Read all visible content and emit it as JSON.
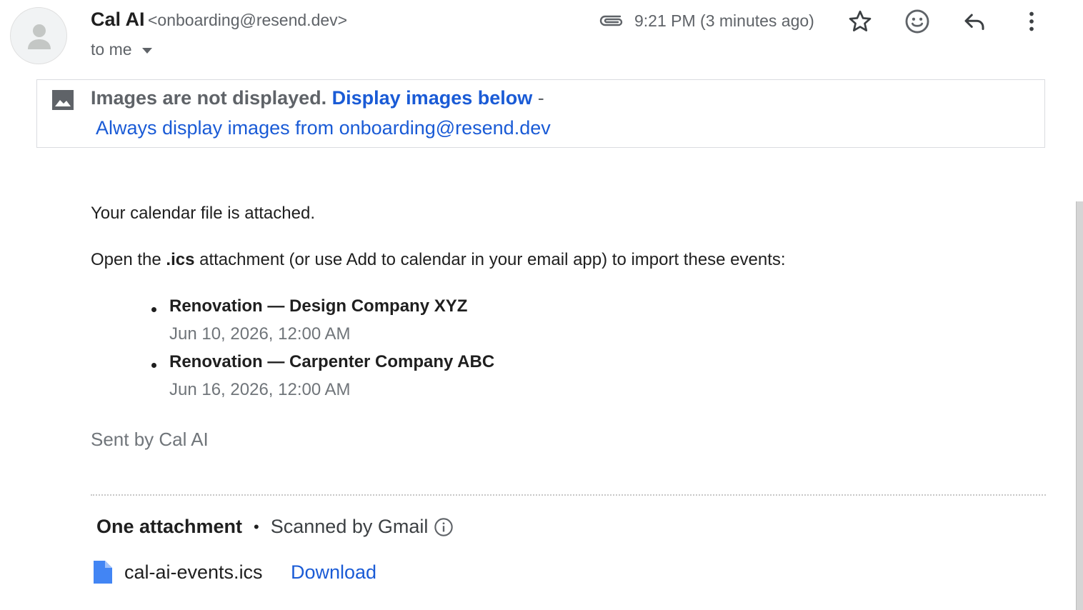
{
  "header": {
    "sender_name": "Cal AI",
    "sender_email": "<onboarding@resend.dev>",
    "recipient_label": "to me",
    "timestamp": "9:21 PM (3 minutes ago)",
    "icons": [
      "attachment-clip-icon",
      "star-icon",
      "emoji-icon",
      "reply-icon",
      "more-vert-icon"
    ]
  },
  "image_banner": {
    "notice": "Images are not displayed.",
    "display_link": "Display images below",
    "separator": "-",
    "always_link": "Always display images from onboarding@resend.dev"
  },
  "message": {
    "line1": "Your calendar file is attached.",
    "line2_prefix": "Open the ",
    "line2_bold": ".ics",
    "line2_suffix": " attachment (or use Add to calendar in your email app) to import these events:",
    "events": [
      {
        "title": "Renovation — Design Company XYZ",
        "date": "Jun 10, 2026, 12:00 AM"
      },
      {
        "title": "Renovation — Carpenter Company ABC",
        "date": "Jun 16, 2026, 12:00 AM"
      }
    ],
    "signature": "Sent by Cal AI"
  },
  "attachments": {
    "count_label": "One attachment",
    "bullet": "•",
    "scan_label": "Scanned by Gmail",
    "file_name": "cal-ai-events.ics",
    "download_label": "Download"
  },
  "colors": {
    "link": "#1a5bd6",
    "muted": "#5f6368",
    "file_icon": "#4285f4"
  }
}
